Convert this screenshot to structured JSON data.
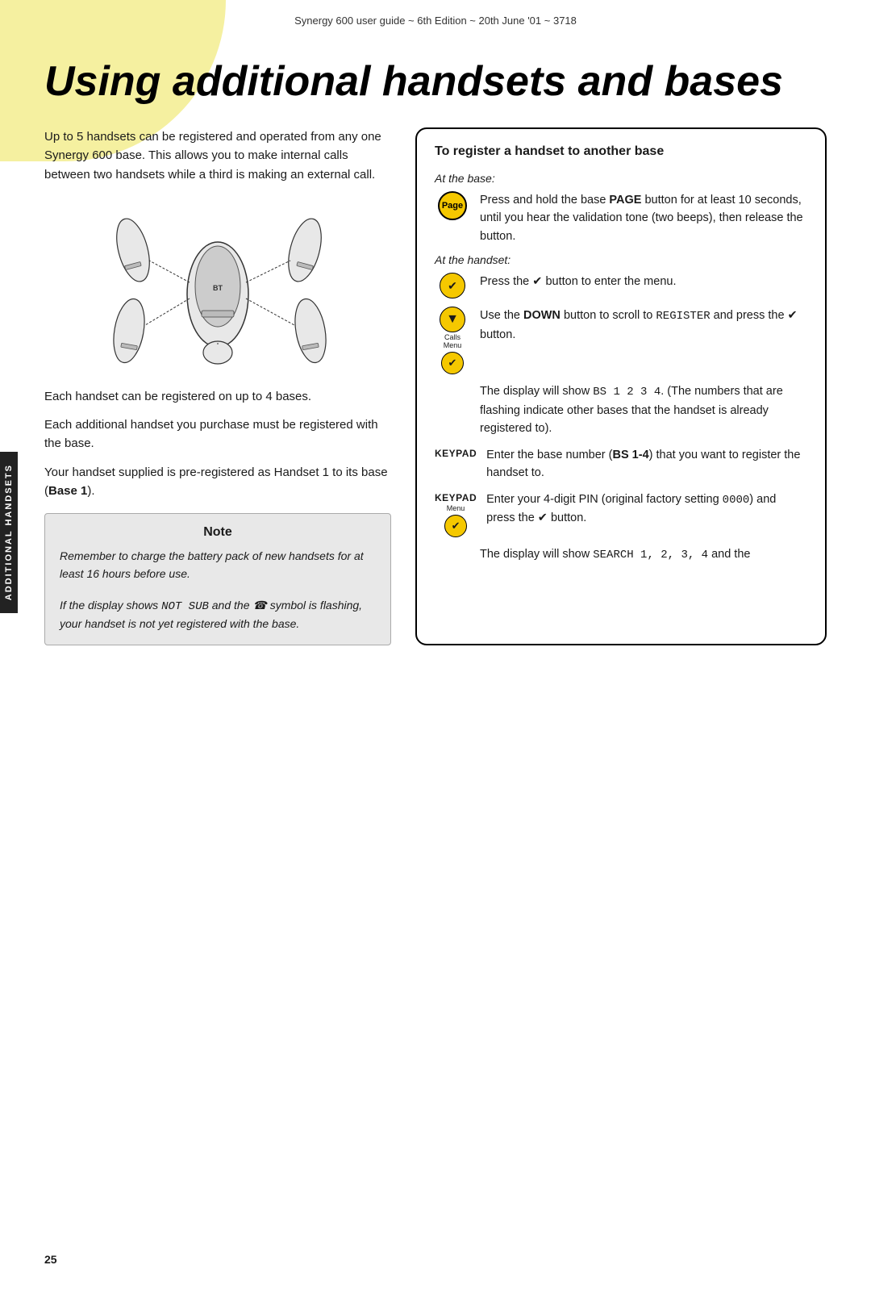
{
  "header": {
    "text": "Synergy 600 user guide ~ 6th Edition ~ 20th June '01 ~ 3718"
  },
  "title": "Using additional handsets and bases",
  "intro": "Up to 5 handsets can be registered and operated from any one Synergy 600 base. This allows you to make internal calls between two handsets while a third is making an external call.",
  "below_diagram": [
    "Each handset can be registered on up to 4 bases.",
    "Each additional handset you purchase must be registered with the base.",
    "Your handset supplied is pre-registered as Handset 1 to its base (Base 1)."
  ],
  "note": {
    "title": "Note",
    "paragraphs": [
      "Remember to charge the battery pack of new handsets for at least 16 hours before use.",
      "If the display shows NOT SUB and the ☎ symbol is flashing, your handset is not yet registered with the base."
    ]
  },
  "register_box": {
    "title": "To register a handset to another base",
    "at_base_label": "At the base:",
    "at_handset_label": "At the handset:",
    "steps": [
      {
        "icon_type": "page",
        "icon_label": "Page",
        "text": "Press and hold the base PAGE button for at least 10 seconds, until you hear the validation tone (two beeps), then release the button."
      },
      {
        "icon_type": "menu-check",
        "icon_label": "Menu ✔",
        "text": "Press the ✔ button to enter the menu."
      },
      {
        "icon_type": "down-calls",
        "icon_label": "▼ Calls Menu ✔",
        "text": "Use the DOWN button to scroll to REGISTER and press the ✔ button."
      },
      {
        "icon_type": "text-block",
        "text": "The display will show BS 1 2 3 4. (The numbers that are flashing indicate other bases that the handset is already registered to)."
      },
      {
        "icon_type": "keypad",
        "icon_label": "KEYPAD",
        "text": "Enter the base number (BS 1-4) that you want to register the handset to."
      },
      {
        "icon_type": "keypad-menu",
        "icon_label": "KEYPAD Menu ✔",
        "text": "Enter your 4-digit PIN (original factory setting 0000) and press the ✔ button."
      },
      {
        "icon_type": "text-block",
        "text": "The display will show SEARCH 1, 2, 3, 4 and the"
      }
    ]
  },
  "page_number": "25",
  "side_tab": "ADDITIONAL HANDSETS"
}
